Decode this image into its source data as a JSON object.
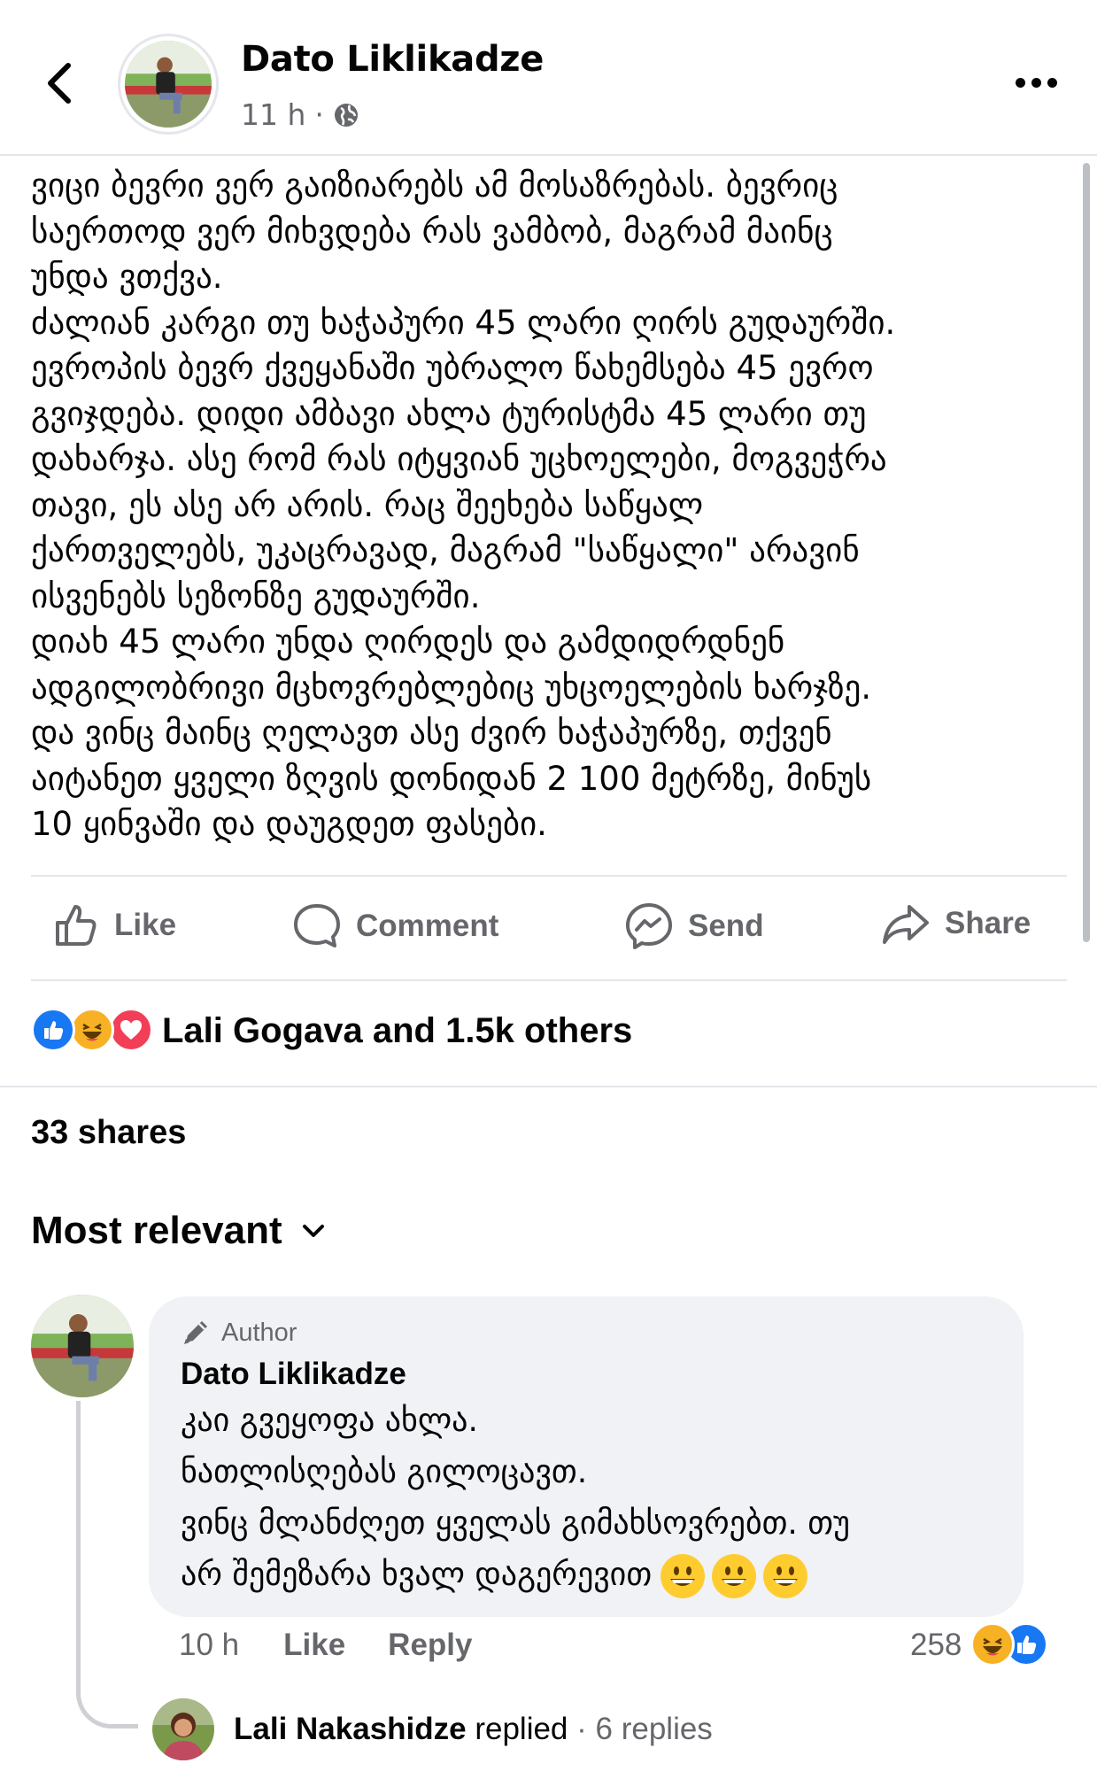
{
  "post": {
    "author": "Dato Liklikadze",
    "time": "11 h",
    "separator": "·",
    "text": "ვიცი ბევრი ვერ გაიზიარებს ამ მოსაზრებას. ბევრიც\nსაერთოდ ვერ მიხვდება რას ვამბობ, მაგრამ მაინც\nუნდა ვთქვა.\nძალიან კარგი თუ ხაჭაპური 45 ლარი ღირს გუდაურში.\nევროპის ბევრ ქვეყანაში უბრალო წახემსება 45 ევრო\nგვიჯდება. დიდი ამბავი ახლა ტურისტმა 45 ლარი თუ\nდახარჯა.  ასე რომ რას იტყვიან უცხოელები, მოგვეჭრა\nთავი, ეს ასე არ არის. რაც შეეხება საწყალ\nქართველებს, უკაცრავად, მაგრამ \"საწყალი\" არავინ\nისვენებს სეზონზე გუდაურში.\nდიახ 45 ლარი უნდა ღირდეს და გამდიდრდნენ\nადგილობრივი მცხოვრებლებიც უხცოელების ხარჯზე.\nდა ვინც მაინც ღელავთ ასე ძვირ ხაჭაპურზე, თქვენ\nაიტანეთ ყველი ზღვის დონიდან 2 100 მეტრზე, მინუს\n10 ყინვაში და დაუგდეთ ფასები."
  },
  "actions": {
    "like": "Like",
    "comment": "Comment",
    "send": "Send",
    "share": "Share"
  },
  "reactions": {
    "summary": "Lali Gogava and 1.5k others",
    "icons": [
      "like-icon",
      "haha-icon",
      "love-icon"
    ]
  },
  "shares": "33 shares",
  "sort": {
    "label": "Most relevant"
  },
  "comment": {
    "badge": "Author",
    "author": "Dato Liklikadze",
    "text": "კაი გვეყოფა ახლა.\nნათლისღებას გილოცავთ.\nვინც მლანძღეთ ყველას გიმახსოვრებთ. თუ\nარ შემეზარა ხვალ დაგერევით",
    "emojis": [
      "grinning-emoji",
      "grinning-emoji",
      "grinning-emoji"
    ],
    "time": "10 h",
    "like": "Like",
    "reply": "Reply",
    "reaction_count": "258"
  },
  "reply_summary": {
    "name": "Lali Nakashidze",
    "action": " replied",
    "separator": " · ",
    "count": "6 replies"
  },
  "colors": {
    "text": "#050505",
    "muted": "#65676b",
    "divider": "#e4e6eb",
    "bubble": "#f0f2f5",
    "like_blue": "#1877f2",
    "love_red": "#f33e58",
    "haha_yellow": "#f7b125"
  }
}
